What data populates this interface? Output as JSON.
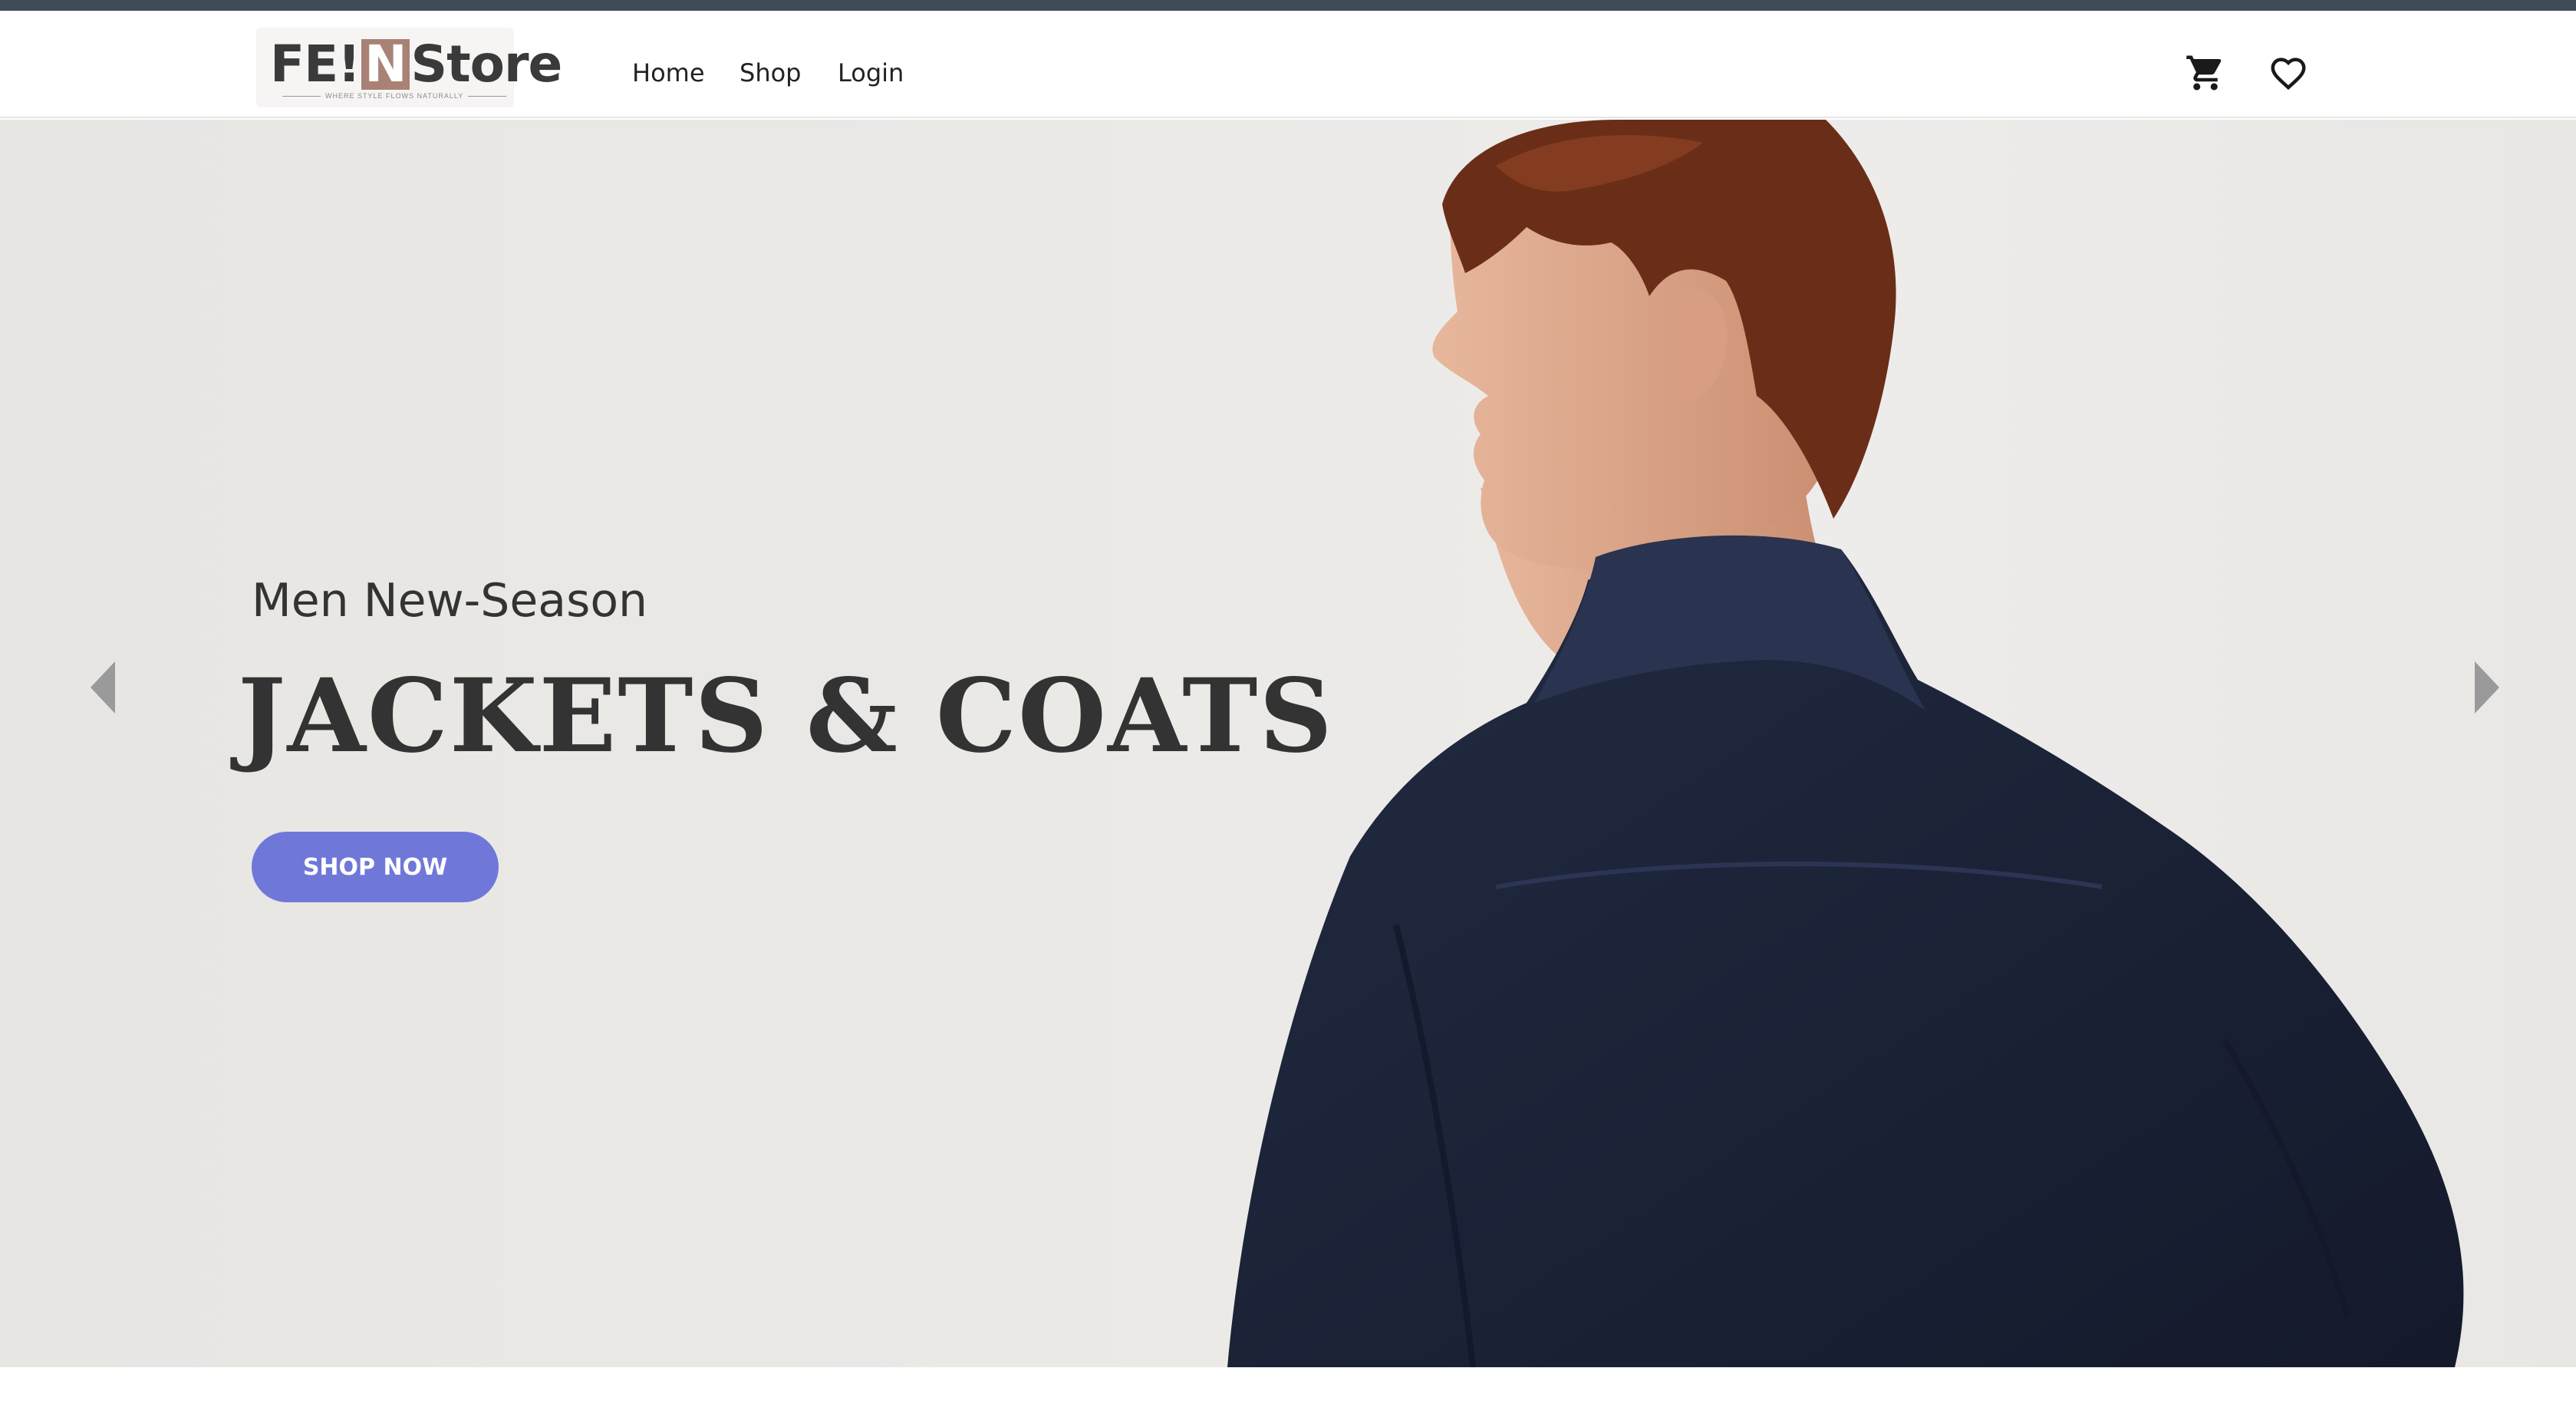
{
  "header": {
    "logo": {
      "brand_prefix": "FE!",
      "brand_n": "N",
      "brand_suffix": "Store",
      "tagline": "WHERE STYLE FLOWS NATURALLY"
    },
    "nav": [
      {
        "label": "Home"
      },
      {
        "label": "Shop"
      },
      {
        "label": "Login"
      }
    ],
    "icons": [
      "cart-icon",
      "heart-icon"
    ]
  },
  "hero": {
    "subtitle": "Men New-Season",
    "headline": "JACKETS & COATS",
    "cta_label": "SHOP NOW",
    "prev_icon": "chevron-left-icon",
    "next_icon": "chevron-right-icon"
  },
  "colors": {
    "top_bar": "#3f4b57",
    "accent": "#6f78d9",
    "logo_n_bg": "#a98276",
    "jacket": "#1c2438",
    "text": "#333333"
  }
}
